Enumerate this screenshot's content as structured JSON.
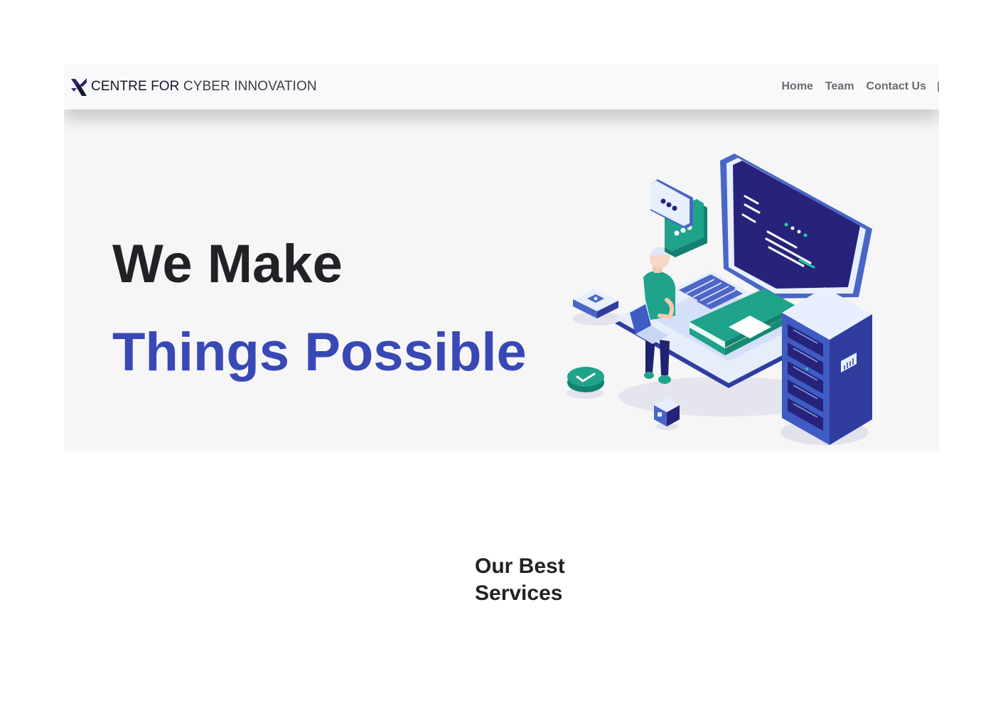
{
  "navbar": {
    "brand": {
      "bold_text": "CENTRE FOR",
      "light_text": "CYBER INNOVATION"
    },
    "links": [
      {
        "label": "Home"
      },
      {
        "label": "Team"
      },
      {
        "label": "Contact Us"
      }
    ]
  },
  "hero": {
    "line1": "We Make",
    "line2": "Things Possible",
    "accent_color": "#3848b5"
  },
  "services": {
    "title_line1": "Our Best",
    "title_line2": "Services"
  },
  "colors": {
    "hero_background": "#f6f6f7",
    "navbar_background": "#f8f9fa",
    "laptop_screen": "#27237a",
    "teal": "#1fa38a",
    "blue": "#3f5bc4"
  }
}
